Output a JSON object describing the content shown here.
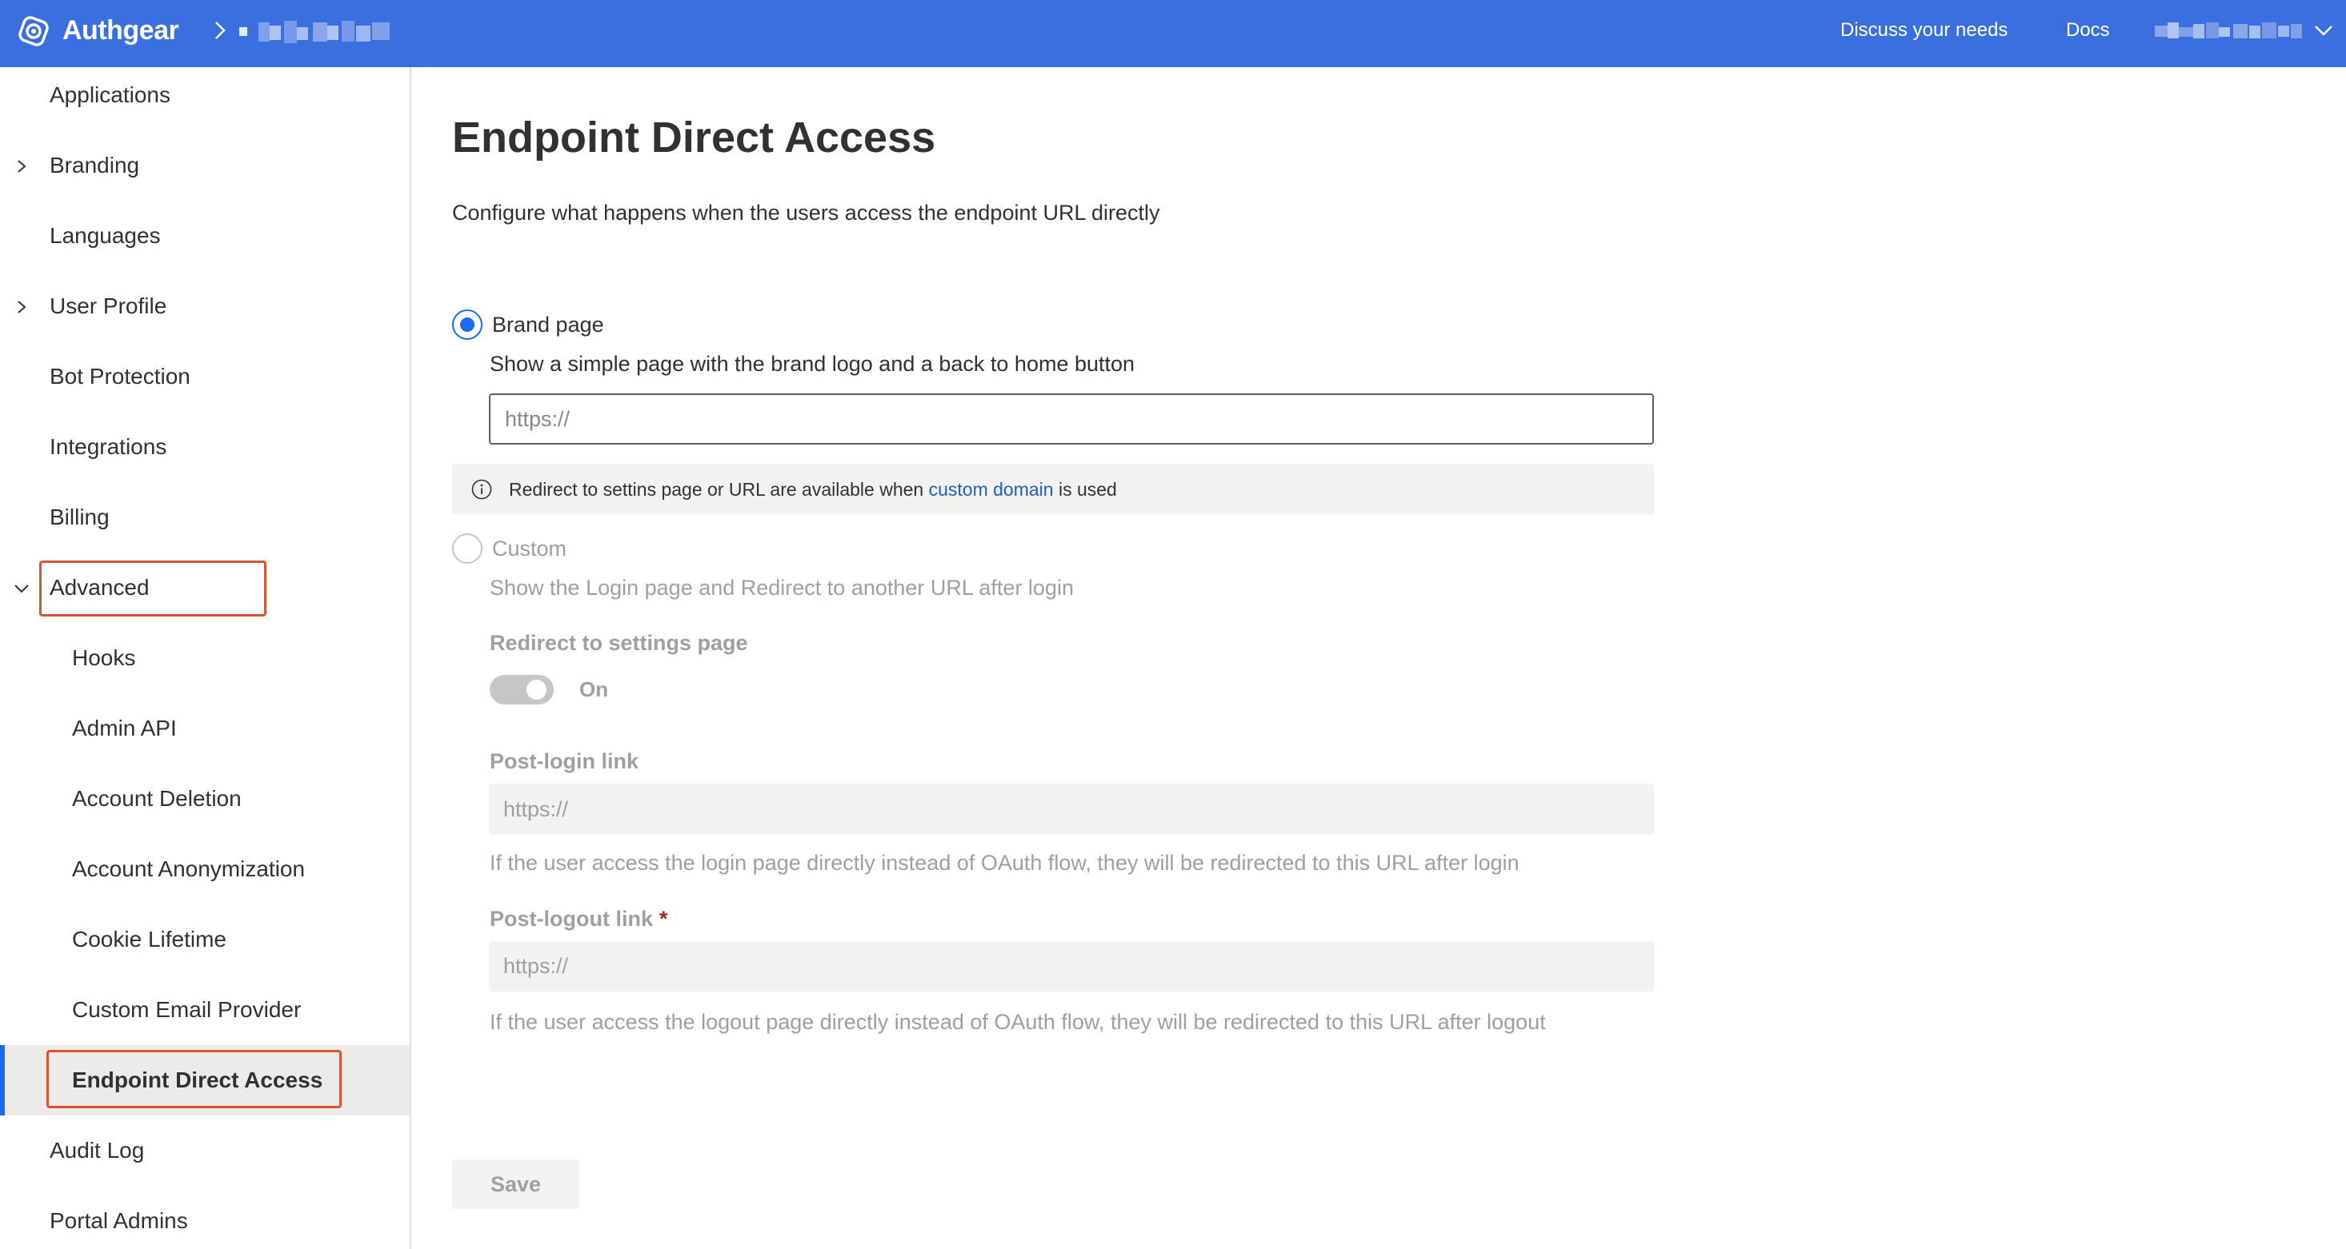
{
  "theme": {
    "header_bg": "#3b6fe0",
    "accent": "#176df3",
    "highlight_box": "#d9532f",
    "disabled_text": "#a19f9d",
    "link": "#1f5fbf"
  },
  "header": {
    "logo_icon": "authgear-logo-icon",
    "app_name": "Authgear",
    "breadcrumb_icon": "chevron-right-icon",
    "links": [
      {
        "label": "Discuss your needs"
      },
      {
        "label": "Docs"
      }
    ],
    "account_menu_icon": "chevron-down-icon"
  },
  "sidebar": {
    "items": [
      {
        "label": "Applications"
      },
      {
        "label": "Branding",
        "icon": "chevron-right-icon",
        "expanded": false
      },
      {
        "label": "Languages"
      },
      {
        "label": "User Profile",
        "icon": "chevron-right-icon",
        "expanded": false
      },
      {
        "label": "Bot Protection"
      },
      {
        "label": "Integrations"
      },
      {
        "label": "Billing"
      },
      {
        "label": "Advanced",
        "icon": "chevron-down-icon",
        "expanded": true,
        "highlighted": true,
        "children": [
          {
            "label": "Hooks"
          },
          {
            "label": "Admin API"
          },
          {
            "label": "Account Deletion"
          },
          {
            "label": "Account Anonymization"
          },
          {
            "label": "Cookie Lifetime"
          },
          {
            "label": "Custom Email Provider"
          },
          {
            "label": "Endpoint Direct Access",
            "selected": true,
            "highlighted": true
          }
        ]
      },
      {
        "label": "Audit Log"
      },
      {
        "label": "Portal Admins"
      }
    ]
  },
  "page": {
    "title": "Endpoint Direct Access",
    "description": "Configure what happens when the users access the endpoint URL directly",
    "options": [
      {
        "label": "Brand page",
        "description": "Show a simple page with the brand logo and a back to home button",
        "selected": true,
        "disabled": false,
        "url_input": {
          "value": "",
          "placeholder": "https://"
        }
      },
      {
        "label": "Custom",
        "description": "Show the Login page and Redirect to another URL after login",
        "selected": false,
        "disabled": true
      }
    ],
    "info_banner": {
      "icon": "info-icon",
      "text_before": "Redirect to settins page or URL are available when ",
      "link": "custom domain",
      "text_after": " is used"
    },
    "custom": {
      "redirect_toggle": {
        "label": "Redirect to settings page",
        "on": true,
        "state_text": "On"
      },
      "post_login": {
        "label": "Post-login link",
        "value": "",
        "placeholder": "https://",
        "help": "If the user access the login page directly instead of OAuth flow, they will be redirected to this URL after login"
      },
      "post_logout": {
        "label": "Post-logout link",
        "required_mark": "*",
        "value": "",
        "placeholder": "https://",
        "help": "If the user access the logout page directly instead of OAuth flow, they will be redirected to this URL after logout"
      }
    },
    "save_label": "Save"
  }
}
